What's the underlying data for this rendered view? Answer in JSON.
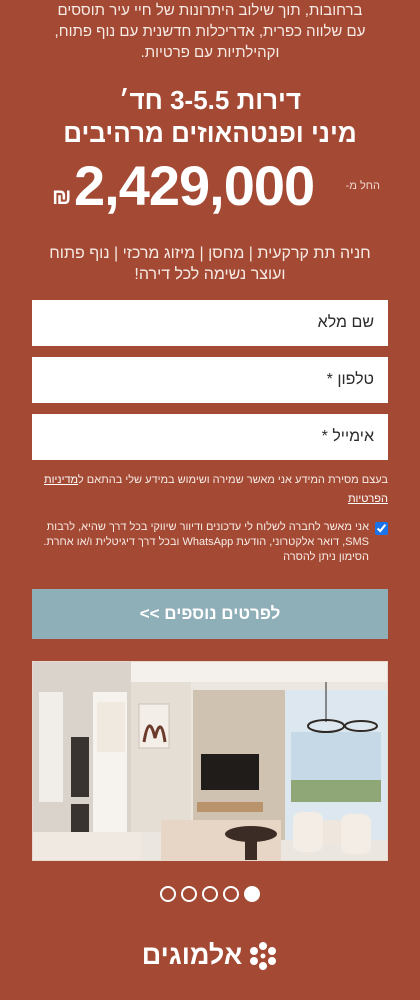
{
  "intro": {
    "line1": "ברחובות, תוך שילוב היתרונות של חיי עיר תוססים",
    "line2": "עם שלווה כפרית, אדריכלות חדשנית עם נוף פתוח,",
    "line3": "וקהילתיות עם פרטיות."
  },
  "headline": {
    "line1": "דירות 3-5.5 חד׳",
    "line2": "מיני ופנטהאוזים מרהיבים"
  },
  "price": {
    "from_label": "החל מ-",
    "amount": "2,429,000",
    "currency": "₪"
  },
  "features": {
    "line1": "חניה תת קרקעית | מחסן | מיזוג מרכזי | נוף פתוח",
    "line2": "ועוצר נשימה לכל דירה!"
  },
  "form": {
    "name_placeholder": "שם מלא",
    "phone_placeholder": "טלפון *",
    "email_placeholder": "אימייל *",
    "privacy_text": "בעצם מסירת המידע אני מאשר שמירה ושימוש במידע שלי בהתאם ל",
    "privacy_link": "מדיניות הפרטיות",
    "consent_text": "אני מאשר לחברה לשלוח לי עדכונים ודיוור שיווקי בכל דרך שהיא, לרבות SMS, דואר אלקטרוני, הודעת WhatsApp ובכל דרך דיגיטלית ו/או אחרת. הסימון ניתן להסרה",
    "consent_checked": true,
    "submit_label": "לפרטים נוספים >>"
  },
  "gallery": {
    "dots": [
      true,
      false,
      false,
      false,
      false
    ],
    "photo_icon": "living-room-photo"
  },
  "brand": {
    "name": "אלמוגים",
    "icon": "almogim-dots-logo-icon"
  },
  "colors": {
    "background": "#a44a34",
    "button": "#8eaeb8",
    "text": "#ffffff"
  }
}
